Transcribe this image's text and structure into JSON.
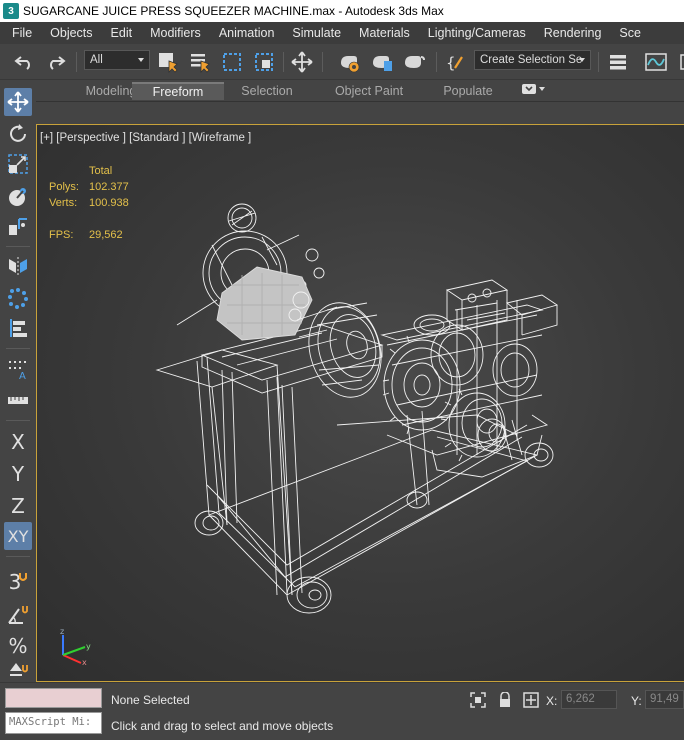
{
  "window": {
    "title": "SUGARCANE JUICE PRESS SQUEEZER MACHINE.max - Autodesk 3ds Max",
    "app_icon": "3"
  },
  "menu": {
    "items": [
      "File",
      "Objects",
      "Edit",
      "Modifiers",
      "Animation",
      "Simulate",
      "Materials",
      "Lighting/Cameras",
      "Rendering",
      "Sce"
    ]
  },
  "toolbar": {
    "selection_filter": "All",
    "named_selection_set": "Create Selection Se",
    "icons": [
      "undo-icon",
      "redo-icon",
      "select-object-icon",
      "select-by-name-icon",
      "rectangular-selection-icon",
      "window-crossing-icon",
      "select-and-move-icon",
      "render-setup-icon",
      "render-frame-icon",
      "render-icon",
      "edit-named-selection-icon",
      "layer-explorer-icon",
      "curve-editor-icon"
    ]
  },
  "ribbon": {
    "tabs": [
      "Modeling",
      "Freeform",
      "Selection",
      "Object Paint",
      "Populate"
    ],
    "active_tab": "Freeform"
  },
  "left_panel": {
    "tools": [
      "select-move-icon",
      "rotate-icon",
      "scale-icon",
      "place-icon",
      "pivot-icon",
      "mirror-icon",
      "array-icon",
      "align-icon",
      "spacing-icon",
      "measure-icon"
    ],
    "axis_x": "X",
    "axis_y": "Y",
    "axis_z": "Z",
    "axis_xy": "XY",
    "snap_3": "3",
    "angle_snap": "∠",
    "percent_snap": "%",
    "spinner_snap": "▲"
  },
  "viewport": {
    "label": "[+] [Perspective ] [Standard ] [Wireframe ]",
    "stats": {
      "header": "Total",
      "polys_label": "Polys:",
      "polys_value": "102.377",
      "verts_label": "Verts:",
      "verts_value": "100.938",
      "fps_label": "FPS:",
      "fps_value": "29,562"
    },
    "gizmo": {
      "x": "x",
      "y": "y",
      "z": "z"
    },
    "border_color": "#c8a23a"
  },
  "status": {
    "maxscript_placeholder": "MAXScript Mi:",
    "selection": "None Selected",
    "prompt": "Click and drag to select and move objects",
    "x_label": "X:",
    "x_value": "6,262",
    "y_label": "Y:",
    "y_value": "91,49"
  }
}
